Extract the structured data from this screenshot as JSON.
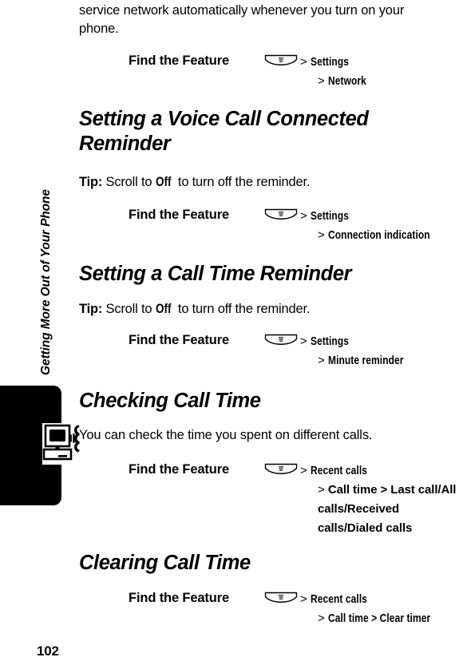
{
  "page": {
    "number": "102",
    "running_head": "Getting More Out of Your Phone"
  },
  "intro": {
    "line1": "service network automatically whenever you turn on your",
    "line2": "phone."
  },
  "labels": {
    "find_the_feature": "Find the Feature",
    "tip_prefix": "Tip:",
    "menu_icon": "menu-key-icon",
    "chapter_icon": "data-call-icon"
  },
  "sections": [
    {
      "id": "network-selection",
      "heading": null,
      "feature": {
        "label": "Find the Feature",
        "lines": [
          {
            "gt": ">",
            "text": "Settings"
          },
          {
            "gt": ">",
            "text": "Network"
          }
        ]
      }
    },
    {
      "id": "voice-call-connected-reminder",
      "heading": "Setting a Voice Call Connected Reminder",
      "tip": {
        "prefix": "Tip:",
        "before": " Scroll to ",
        "value": "Off",
        "after": " to turn off the reminder."
      },
      "feature": {
        "label": "Find the Feature",
        "lines": [
          {
            "gt": ">",
            "text": "Settings"
          },
          {
            "gt": ">",
            "text": "Connection indication"
          }
        ]
      }
    },
    {
      "id": "call-time-reminder",
      "heading": "Setting a Call Time Reminder",
      "tip": {
        "prefix": "Tip:",
        "before": " Scroll to ",
        "value": "Off",
        "after": " to turn off the reminder."
      },
      "feature": {
        "label": "Find the Feature",
        "lines": [
          {
            "gt": ">",
            "text": "Settings"
          },
          {
            "gt": ">",
            "text": "Minute reminder"
          }
        ]
      }
    },
    {
      "id": "checking-call-time",
      "heading": "Checking Call Time",
      "body": "You can check the time you spent on different calls.",
      "feature": {
        "label": "Find the Feature",
        "lines": [
          {
            "gt": ">",
            "text": "Recent calls"
          },
          {
            "gt": ">",
            "text": "Call time > Last call/All calls/Received calls/Dialed calls"
          }
        ]
      }
    },
    {
      "id": "clearing-call-time",
      "heading": "Clearing Call Time",
      "feature": {
        "label": "Find the Feature",
        "lines": [
          {
            "gt": ">",
            "text": "Recent calls"
          },
          {
            "gt": ">",
            "text": "Call time > Clear timer"
          }
        ]
      }
    }
  ],
  "colors": {
    "text": "#000000",
    "background": "#ffffff",
    "tab": "#000000"
  }
}
